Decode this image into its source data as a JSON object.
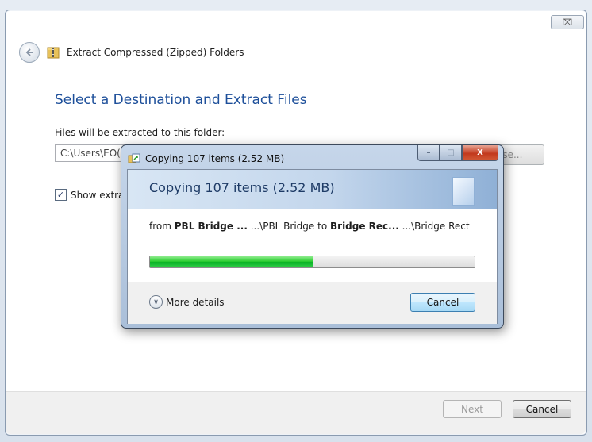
{
  "wizard": {
    "close_label": "⌧",
    "title": "Extract Compressed (Zipped) Folders",
    "heading": "Select a Destination and Extract Files",
    "dest_label": "Files will be extracted to this folder:",
    "dest_value": "C:\\Users\\EO(",
    "browse_label": "wse...",
    "show_files_label": "Show extra",
    "show_files_checked": true,
    "next_label": "Next",
    "cancel_label": "Cancel"
  },
  "copy_dialog": {
    "title": "Copying 107 items (2.52 MB)",
    "banner_text": "Copying 107 items (2.52 MB)",
    "from_word": "from",
    "source_name": "PBL Bridge ...",
    "source_path": "...\\PBL Bridge",
    "to_word": "to",
    "dest_name": "Bridge Rec...",
    "dest_path": "...\\Bridge Rect",
    "progress_fraction": 0.5,
    "more_details_label": "More details",
    "cancel_label": "Cancel",
    "caption": {
      "minimize": "–",
      "maximize": "□",
      "close": "X"
    }
  },
  "icons": {
    "back": "back-arrow-icon",
    "zip": "zip-folder-icon",
    "copy": "copy-files-icon",
    "chevron": "chevron-down-icon"
  },
  "colors": {
    "heading": "#1d4f9a",
    "progress": "#06b025"
  }
}
